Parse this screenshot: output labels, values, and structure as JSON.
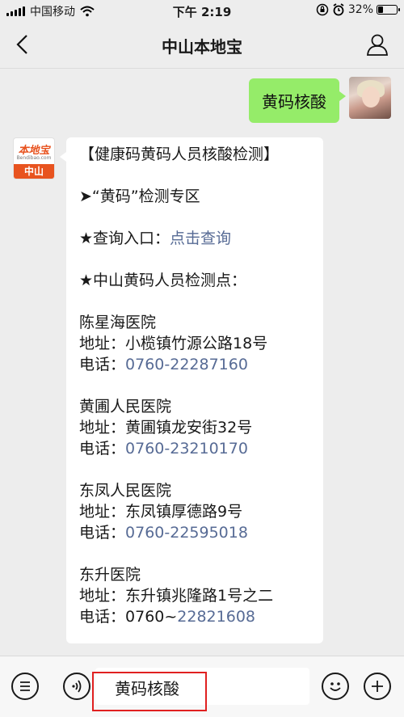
{
  "status_bar": {
    "carrier": "中国移动",
    "time": "下午 2:19",
    "battery_percent": "32%",
    "battery_level": 0.32,
    "icons": [
      "signal-icon",
      "wifi-icon",
      "lock-rotation-icon",
      "alarm-icon",
      "battery-icon"
    ]
  },
  "nav": {
    "title": "中山本地宝",
    "icons": [
      "back-arrow-icon",
      "user-profile-icon"
    ]
  },
  "chat": {
    "sent_message": "黄码核酸",
    "app_logo": {
      "text": "本地宝",
      "subtext": "Bendibao.com",
      "city": "中山",
      "color": "#e8531f"
    },
    "reply": {
      "title": "【健康码黄码人员核酸检测】",
      "zone": "➤“黄码”检测专区",
      "query_label": "★查询入口：",
      "query_link": "点击查询",
      "points_title": "★中山黄码人员检测点：",
      "address_label": "地址：",
      "phone_label": "电话：",
      "hospitals": [
        {
          "name": "陈星海医院",
          "address": "小榄镇竹源公路18号",
          "phone_prefix": "",
          "phone": "0760-22287160"
        },
        {
          "name": "黄圃人民医院",
          "address": "黄圃镇龙安街32号",
          "phone_prefix": "",
          "phone": "0760-23210170"
        },
        {
          "name": "东凤人民医院",
          "address": "东凤镇厚德路9号",
          "phone_prefix": "",
          "phone": "0760-22595018"
        },
        {
          "name": "东升医院",
          "address": "东升镇兆隆路1号之二",
          "phone_prefix": "0760~",
          "phone": "22821608"
        }
      ]
    }
  },
  "input_bar": {
    "text": "黄码核酸",
    "icons": [
      "menu-list-icon",
      "voice-icon",
      "emoji-icon",
      "plus-icon"
    ],
    "highlight_color": "#e02020"
  }
}
